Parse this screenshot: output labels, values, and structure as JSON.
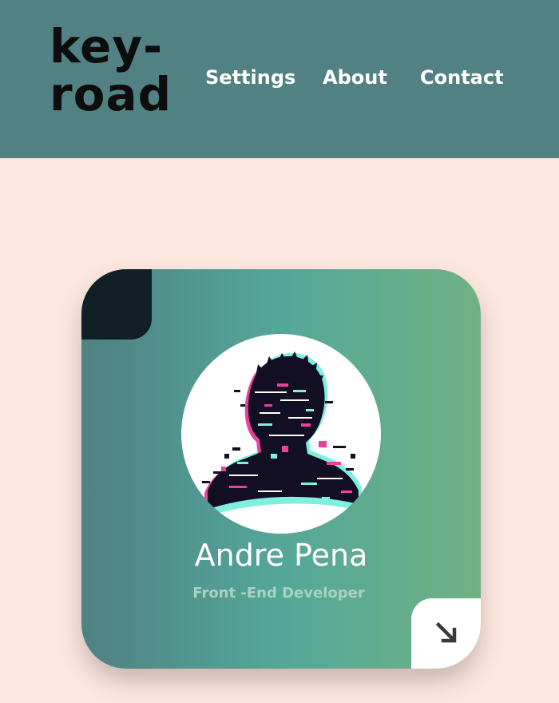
{
  "header": {
    "logo_line1": "key-",
    "logo_line2": "road",
    "nav": [
      {
        "label": "Settings"
      },
      {
        "label": "About"
      },
      {
        "label": "Contact"
      }
    ]
  },
  "profile_card": {
    "name": "Andre Pena",
    "role": "Front -End Developer",
    "avatar_icon": "glitch-silhouette-portrait",
    "action_icon": "arrow-down-right-icon"
  },
  "colors": {
    "page_background": "#fde8df",
    "header_background": "#528183",
    "card_gradient": [
      "#4f8183",
      "#54a799",
      "#71b183"
    ],
    "card_corner": "#0f1f24",
    "glitch_pink": "#ee3f9a",
    "glitch_cyan": "#7ff0e0"
  }
}
